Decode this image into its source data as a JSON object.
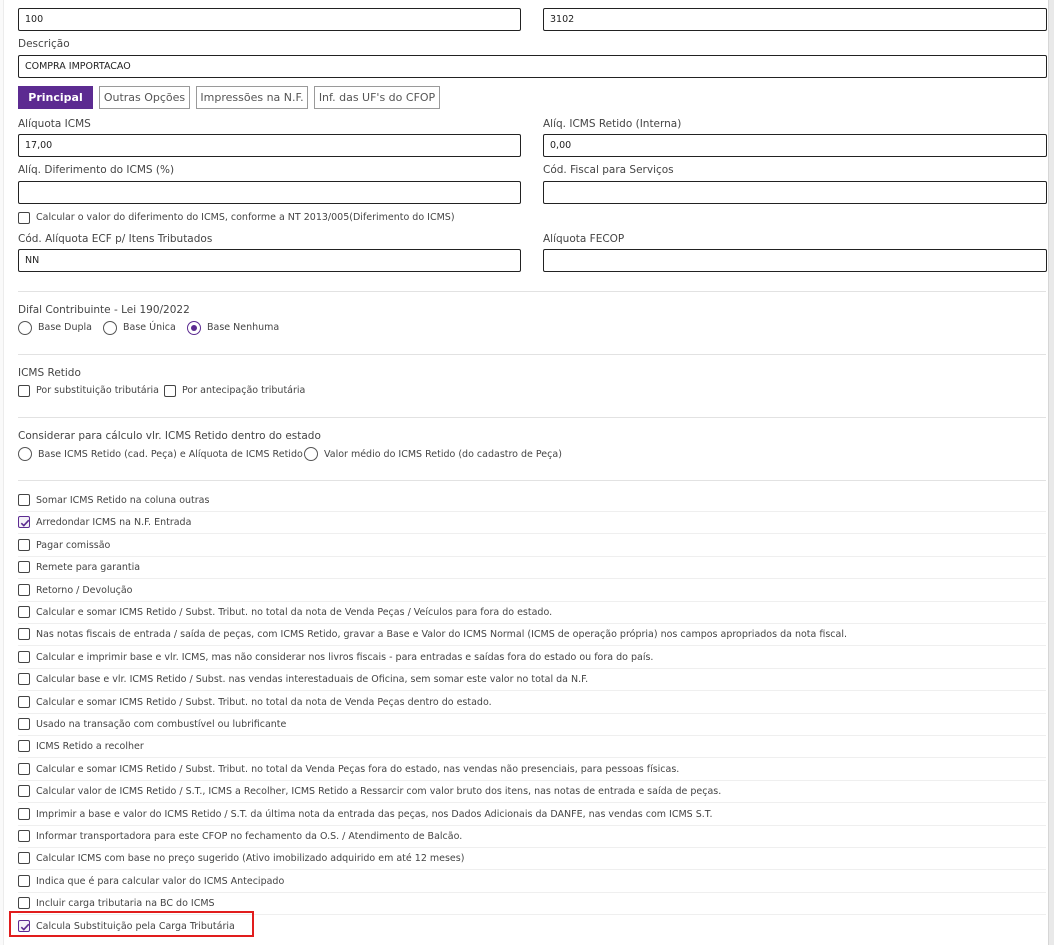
{
  "top_fields": {
    "left_value": "100",
    "right_value": "3102"
  },
  "descricao": {
    "label": "Descrição",
    "value": "COMPRA IMPORTACAO"
  },
  "tabs": [
    {
      "label": "Principal",
      "active": true
    },
    {
      "label": "Outras Opções",
      "active": false
    },
    {
      "label": "Impressões na N.F.",
      "active": false
    },
    {
      "label": "Inf. das UF's do CFOP",
      "active": false
    }
  ],
  "fields": {
    "aliquota_icms": {
      "label": "Alíquota ICMS",
      "value": "17,00"
    },
    "aliq_icms_retido": {
      "label": "Alíq. ICMS Retido (Interna)",
      "value": "0,00"
    },
    "aliq_diferimento": {
      "label": "Alíq. Diferimento do ICMS (%)",
      "value": ""
    },
    "cod_fiscal_servicos": {
      "label": "Cód. Fiscal para Serviços",
      "value": ""
    },
    "diferimento_checkbox": {
      "label": "Calcular o valor do diferimento do ICMS, conforme a NT 2013/005(Diferimento do ICMS)",
      "checked": false
    },
    "cod_aliquota_ecf": {
      "label": "Cód. Alíquota ECF p/ Itens Tributados",
      "value": "NN"
    },
    "aliquota_fecop": {
      "label": "Alíquota FECOP",
      "value": ""
    }
  },
  "difal": {
    "title": "Difal Contribuinte - Lei 190/2022",
    "options": [
      {
        "label": "Base Dupla",
        "checked": false
      },
      {
        "label": "Base Única",
        "checked": false
      },
      {
        "label": "Base Nenhuma",
        "checked": true
      }
    ]
  },
  "icms_retido": {
    "title": "ICMS Retido",
    "options": [
      {
        "label": "Por substituição tributária",
        "checked": false
      },
      {
        "label": "Por antecipação tributária",
        "checked": false
      }
    ]
  },
  "considerar": {
    "title": "Considerar para cálculo vlr. ICMS Retido dentro do estado",
    "options": [
      {
        "label": "Base ICMS Retido (cad. Peça) e Alíquota de ICMS Retido",
        "checked": false
      },
      {
        "label": "Valor médio do ICMS Retido (do cadastro de Peça)",
        "checked": false
      }
    ]
  },
  "checklist": [
    {
      "label": "Somar ICMS Retido na coluna outras",
      "checked": false
    },
    {
      "label": "Arredondar ICMS na N.F. Entrada",
      "checked": true
    },
    {
      "label": "Pagar comissão",
      "checked": false
    },
    {
      "label": "Remete para garantia",
      "checked": false
    },
    {
      "label": "Retorno / Devolução",
      "checked": false
    },
    {
      "label": "Calcular e somar ICMS Retido / Subst. Tribut. no total da nota de Venda Peças / Veículos para fora do estado.",
      "checked": false
    },
    {
      "label": "Nas notas fiscais de entrada / saída de peças, com ICMS Retido, gravar a Base e Valor do ICMS Normal (ICMS de operação própria) nos campos apropriados da nota fiscal.",
      "checked": false
    },
    {
      "label": "Calcular e imprimir base e vlr. ICMS, mas não considerar nos livros fiscais - para entradas e saídas fora do estado ou fora do país.",
      "checked": false
    },
    {
      "label": "Calcular base e vlr. ICMS Retido / Subst. nas vendas interestaduais de Oficina, sem somar este valor no total da N.F.",
      "checked": false
    },
    {
      "label": "Calcular e somar ICMS Retido / Subst. Tribut. no total da nota de Venda Peças dentro do estado.",
      "checked": false
    },
    {
      "label": "Usado na transação com combustível ou lubrificante",
      "checked": false
    },
    {
      "label": "ICMS Retido a recolher",
      "checked": false
    },
    {
      "label": "Calcular e somar ICMS Retido / Subst. Tribut. no total da Venda Peças fora do estado, nas vendas não presenciais, para pessoas físicas.",
      "checked": false
    },
    {
      "label": "Calcular valor de ICMS Retido / S.T., ICMS a Recolher, ICMS Retido a Ressarcir com valor bruto dos itens, nas notas de entrada e saída de peças.",
      "checked": false
    },
    {
      "label": "Imprimir a base e valor do ICMS Retido / S.T. da última nota da entrada das peças, nos Dados Adicionais da DANFE, nas vendas com ICMS S.T.",
      "checked": false
    },
    {
      "label": "Informar transportadora para este CFOP no fechamento da O.S. / Atendimento de Balcão.",
      "checked": false
    },
    {
      "label": "Calcular ICMS com base no preço sugerido (Ativo imobilizado adquirido em até 12 meses)",
      "checked": false
    },
    {
      "label": "Indica que é para calcular valor do ICMS Antecipado",
      "checked": false
    },
    {
      "label": "Incluir carga tributaria na BC do ICMS",
      "checked": false
    },
    {
      "label": "Calcula Substituição pela Carga Tributária",
      "checked": true
    }
  ],
  "colors": {
    "accent": "#5c2b91",
    "highlight": "#e11d1d"
  }
}
